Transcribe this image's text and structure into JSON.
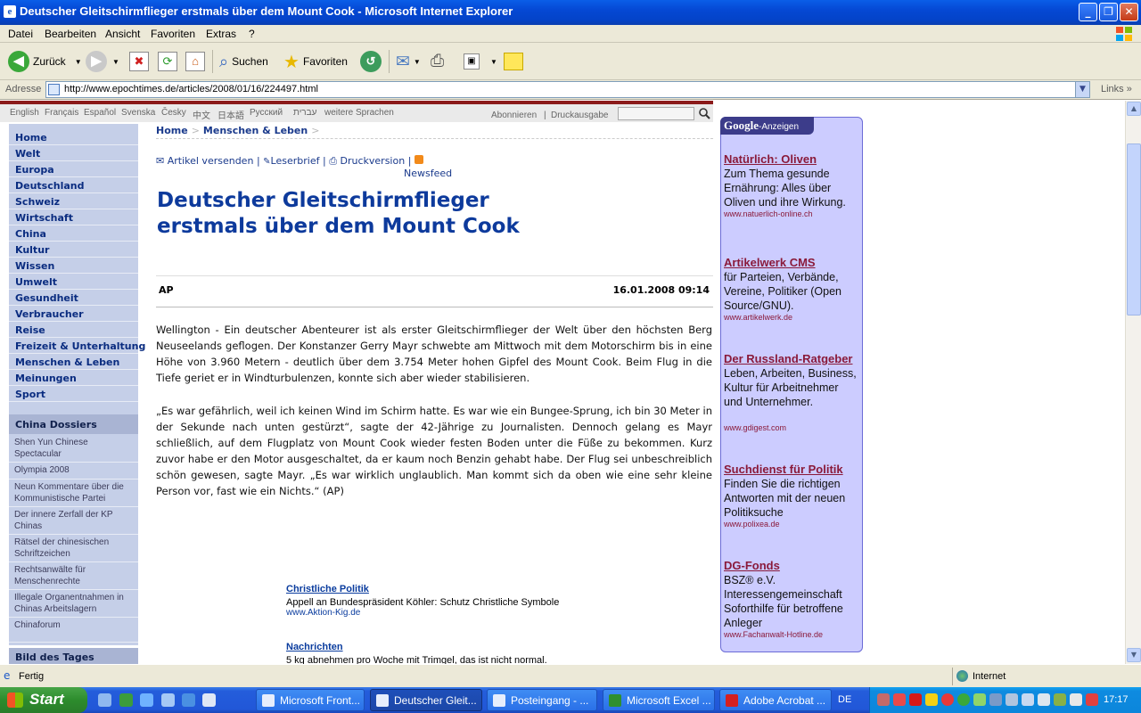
{
  "window": {
    "title": "Deutscher Gleitschirmflieger erstmals über dem Mount Cook - Microsoft Internet Explorer",
    "buttons": {
      "minimize": "_",
      "maximize": "❐",
      "close": "✕"
    }
  },
  "menu": [
    "Datei",
    "Bearbeiten",
    "Ansicht",
    "Favoriten",
    "Extras",
    "?"
  ],
  "toolbar": {
    "back": "Zurück",
    "search": "Suchen",
    "favorites": "Favoriten"
  },
  "address": {
    "label": "Adresse",
    "url": "http://www.epochtimes.de/articles/2008/01/16/224497.html",
    "links": "Links"
  },
  "page": {
    "languages": [
      "English",
      "Français",
      "Español",
      "Svenska",
      "Česky",
      "中文",
      "日本語",
      "Русский",
      "עברית",
      "weitere Sprachen"
    ],
    "top_links": {
      "subscribe": "Abonnieren",
      "sep": "|",
      "print_edition": "Druckausgabe"
    },
    "nav": [
      "Home",
      "Welt",
      "Europa",
      "Deutschland",
      "Schweiz",
      "Wirtschaft",
      "China",
      "Kultur",
      "Wissen",
      "Umwelt",
      "Gesundheit",
      "Verbraucher",
      "Reise",
      "Freizeit & Unterhaltung",
      "Menschen & Leben",
      "Meinungen",
      "Sport"
    ],
    "dossier_heading": "China Dossiers",
    "dossiers": [
      "Shen Yun Chinese Spectacular",
      "Olympia 2008",
      "Neun Kommentare über die Kommunistische Partei",
      "Der innere Zerfall der KP Chinas",
      "Rätsel der chinesischen Schriftzeichen",
      "Rechtsanwälte für Menschenrechte",
      "Illegale Organentnahmen in Chinas Arbeitslagern",
      "Chinaforum"
    ],
    "bild_heading": "Bild des Tages",
    "breadcrumb": {
      "home": "Home",
      "sep": ">",
      "section": "Menschen & Leben",
      "sep2": ">"
    },
    "tools": {
      "send": "Artikel versenden",
      "sep": "|",
      "letter": "Leserbrief",
      "print": "Druckversion",
      "feed": "Newsfeed"
    },
    "headline": "Deutscher Gleitschirmflieger erstmals über dem Mount Cook",
    "source": "AP",
    "date": "16.01.2008 09:14",
    "paragraphs": [
      "Wellington - Ein deutscher Abenteurer ist als erster Gleitschirmflieger der Welt über den höchsten Berg Neuseelands geflogen. Der Konstanzer Gerry Mayr schwebte am Mittwoch mit dem Motorschirm bis in eine Höhe von 3.960 Metern - deutlich über dem 3.754 Meter hohen Gipfel des Mount Cook. Beim Flug in die Tiefe geriet er in Windturbulenzen, konnte sich aber wieder stabilisieren.",
      "„Es war gefährlich, weil ich keinen Wind im Schirm hatte. Es war wie ein Bungee-Sprung, ich bin 30 Meter in der Sekunde nach unten gestürzt“, sagte der 42-Jährige zu Journalisten. Dennoch gelang es Mayr schließlich, auf dem Flugplatz von Mount Cook wieder festen Boden unter die Füße zu bekommen. Kurz zuvor habe er den Motor ausgeschaltet, da er kaum noch Benzin gehabt habe. Der Flug sei unbeschreiblich schön gewesen, sagte Mayr. „Es war wirklich unglaublich. Man kommt sich da oben wie eine sehr kleine Person vor, fast wie ein Nichts.“ (AP)"
    ],
    "inline_ads": [
      {
        "title": "Christliche Politik",
        "text": "Appell an Bundespräsident Köhler: Schutz Christliche Symbole",
        "url": "www.Aktion-Kig.de"
      },
      {
        "title": "Nachrichten",
        "text": "5 kg abnehmen pro Woche mit Trimgel, das ist nicht normal.",
        "url": ""
      }
    ],
    "google_ads_header": {
      "brand": "Google",
      "suffix": "-Anzeigen"
    },
    "google_ads": [
      {
        "title": "Natürlich: Oliven",
        "text": "Zum Thema gesunde Ernährung: Alles über Oliven und ihre Wirkung.",
        "url": "www.natuerlich-online.ch"
      },
      {
        "title": "Artikelwerk CMS",
        "text": "für Parteien, Verbände, Vereine, Politiker (Open Source/GNU).",
        "url": "www.artikelwerk.de"
      },
      {
        "title": "Der Russland-Ratgeber",
        "text": "Leben, Arbeiten, Business, Kultur für Arbeitnehmer und Unternehmer.",
        "url": "www.gdigest.com"
      },
      {
        "title": "Suchdienst für Politik",
        "text": "Finden Sie die richtigen Antworten mit der neuen Politiksuche",
        "url": "www.polixea.de"
      },
      {
        "title": "DG-Fonds",
        "text": "BSZ® e.V. Interessengemeinschaft Soforthilfe für betroffene Anleger",
        "url": "www.Fachanwalt-Hotline.de"
      }
    ]
  },
  "status": {
    "text": "Fertig",
    "zone": "Internet"
  },
  "taskbar": {
    "start": "Start",
    "tasks": [
      "Microsoft Front...",
      "Deutscher Gleit...",
      "Posteingang - ...",
      "Microsoft Excel ...",
      "Adobe Acrobat ..."
    ],
    "lang": "DE",
    "clock": "17:17"
  }
}
